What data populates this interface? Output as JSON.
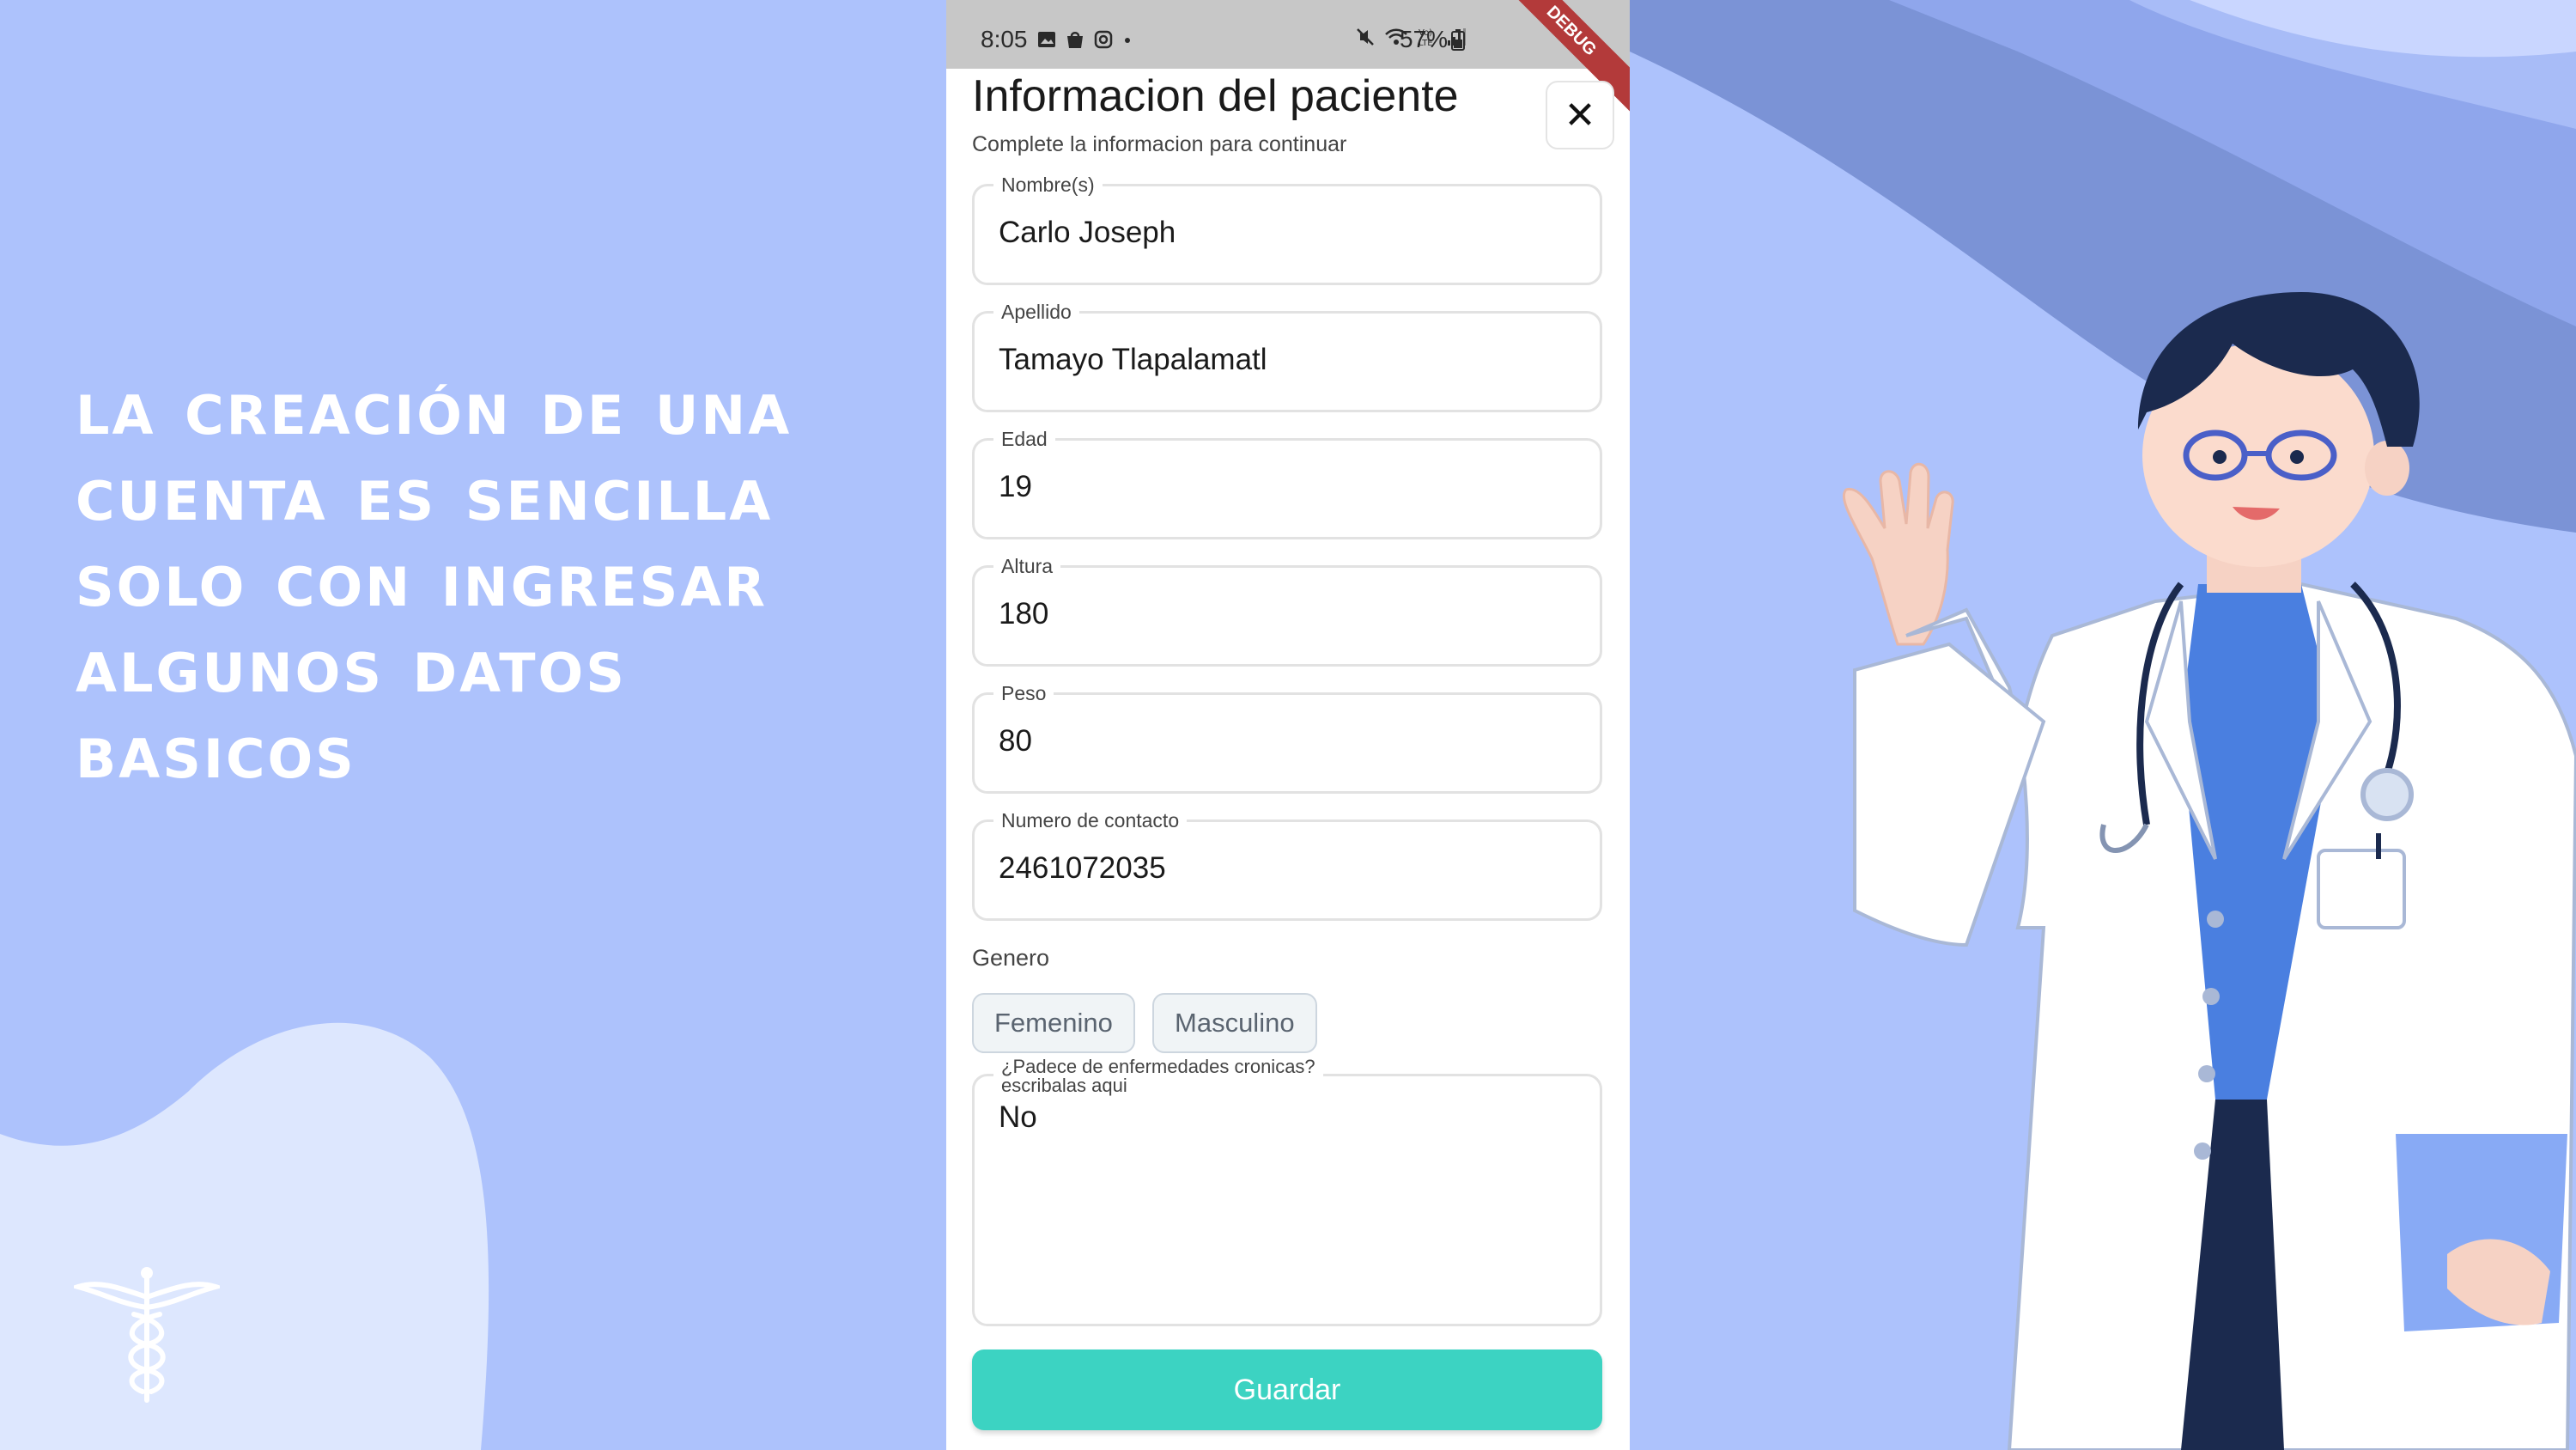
{
  "slide": {
    "headline_lines": [
      "La creación de una",
      "cuenta es sencilla",
      "solo con ingresar",
      "algunos datos",
      "basicos"
    ]
  },
  "status_bar": {
    "time": "8:05",
    "battery": "57%",
    "debug_banner": "DEBUG"
  },
  "form": {
    "title": "Informacion del paciente",
    "subtitle": "Complete la informacion para continuar",
    "close_symbol": "✕",
    "fields": [
      {
        "label": "Nombre(s)",
        "value": "Carlo Joseph"
      },
      {
        "label": "Apellido",
        "value": "Tamayo Tlapalamatl"
      },
      {
        "label": "Edad",
        "value": "19"
      },
      {
        "label": "Altura",
        "value": "180"
      },
      {
        "label": "Peso",
        "value": "80"
      },
      {
        "label": "Numero de contacto",
        "value": "2461072035"
      }
    ],
    "genero_label": "Genero",
    "genero_options": [
      "Femenino",
      "Masculino"
    ],
    "cronicas": {
      "label_line1": "¿Padece de enfermedades cronicas?",
      "label_line2": "escribalas aqui",
      "value": "No"
    },
    "save_label": "Guardar"
  },
  "colors": {
    "background": "#adc2fc",
    "accent_button": "#3cd3c2",
    "headline_text": "#ffffff"
  },
  "icons": [
    "caduceus-icon",
    "close-icon",
    "gallery-icon",
    "shopping-bag-icon",
    "instagram-icon",
    "mute-icon",
    "wifi-icon",
    "volte-icon",
    "signal-icon",
    "battery-icon"
  ]
}
